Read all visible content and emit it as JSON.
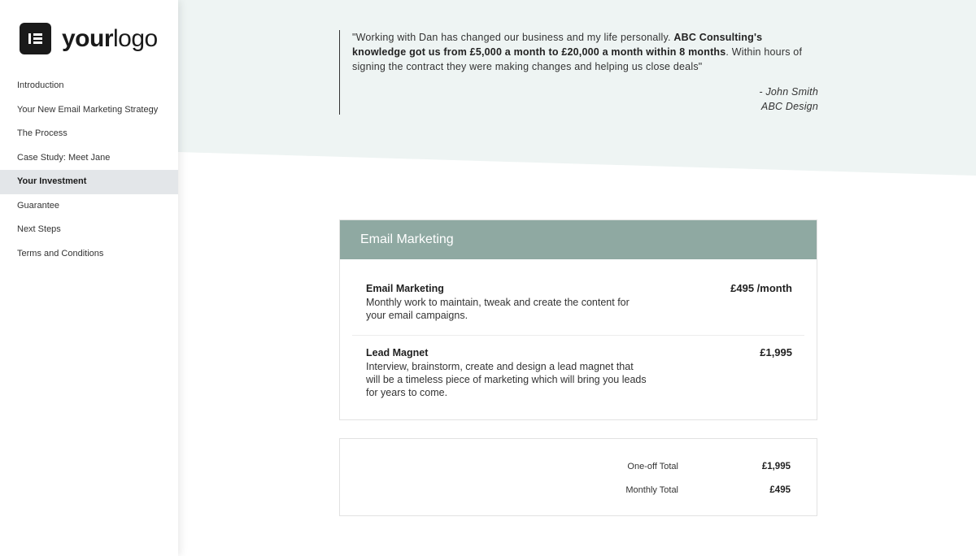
{
  "sidebar": {
    "logo": {
      "part1": "your",
      "part2": "logo",
      "icon": "brand-logo-icon"
    },
    "nav": [
      {
        "label": "Introduction",
        "active": false
      },
      {
        "label": "Your New Email Marketing Strategy",
        "active": false
      },
      {
        "label": "The Process",
        "active": false
      },
      {
        "label": "Case Study: Meet Jane",
        "active": false
      },
      {
        "label": "Your Investment",
        "active": true
      },
      {
        "label": "Guarantee",
        "active": false
      },
      {
        "label": "Next Steps",
        "active": false
      },
      {
        "label": "Terms and Conditions",
        "active": false
      }
    ]
  },
  "testimonial": {
    "quote_start": "\"Working with Dan has changed our business and my life personally. ",
    "quote_bold": "ABC Consulting's knowledge got us from £5,000 a month to £20,000 a month within 8 months",
    "quote_end": ". Within hours of signing the contract they were making changes and helping us close deals\"",
    "author": "- John Smith",
    "company": "ABC Design"
  },
  "pricing": {
    "header": "Email Marketing",
    "items": [
      {
        "title": "Email Marketing",
        "description": "Monthly work to maintain, tweak and create the content for your email campaigns.",
        "price": "£495 /month"
      },
      {
        "title": "Lead Magnet",
        "description": "Interview, brainstorm, create and design a lead magnet that will be a timeless piece of marketing which will bring you leads for years to come.",
        "price": "£1,995"
      }
    ]
  },
  "totals": {
    "one_off_label": "One-off Total",
    "one_off_value": "£1,995",
    "monthly_label": "Monthly Total",
    "monthly_value": "£495"
  },
  "colors": {
    "hero_bg": "#eef4f3",
    "card_header": "#8fa9a2",
    "active_nav_bg": "#e3e6e9"
  }
}
